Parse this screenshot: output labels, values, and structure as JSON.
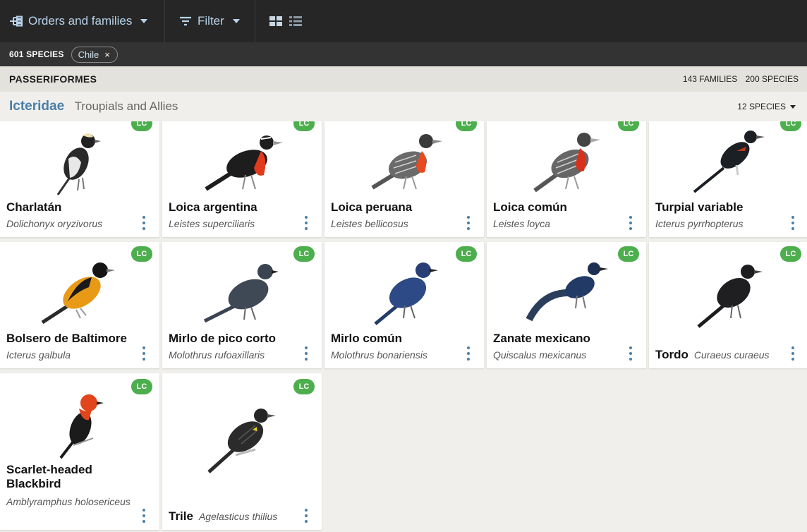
{
  "topbar": {
    "orders_label": "Orders and families",
    "filter_label": "Filter"
  },
  "filterbar": {
    "count": "601 SPECIES",
    "chip": "Chile",
    "chip_remove": "×"
  },
  "order": {
    "name": "PASSERIFORMES",
    "families": "143 FAMILIES",
    "species": "200 SPECIES"
  },
  "family": {
    "name": "Icteridae",
    "common": "Troupials and Allies",
    "count": "12 SPECIES"
  },
  "colors": {
    "topbar": "#262626",
    "link": "#4a7fa8",
    "lc_badge": "#4cae4c"
  },
  "cards": [
    {
      "common": "Charlatán",
      "scientific": "Dolichonyx oryzivorus",
      "status": "LC"
    },
    {
      "common": "Loica argentina",
      "scientific": "Leistes superciliaris",
      "status": "LC"
    },
    {
      "common": "Loica peruana",
      "scientific": "Leistes bellicosus",
      "status": "LC"
    },
    {
      "common": "Loica común",
      "scientific": "Leistes loyca",
      "status": "LC"
    },
    {
      "common": "Turpial variable",
      "scientific": "Icterus pyrrhopterus",
      "status": "LC"
    },
    {
      "common": "Bolsero de Baltimore",
      "scientific": "Icterus galbula",
      "status": "LC"
    },
    {
      "common": "Mirlo de pico corto",
      "scientific": "Molothrus rufoaxillaris",
      "status": "LC"
    },
    {
      "common": "Mirlo común",
      "scientific": "Molothrus bonariensis",
      "status": "LC"
    },
    {
      "common": "Zanate mexicano",
      "scientific": "Quiscalus mexicanus",
      "status": "LC"
    },
    {
      "common": "Tordo",
      "scientific": "Curaeus curaeus",
      "status": "LC"
    },
    {
      "common": "Scarlet-headed Blackbird",
      "scientific": "Amblyramphus holosericeus",
      "status": "LC"
    },
    {
      "common": "Trile",
      "scientific": "Agelasticus thilius",
      "status": "LC"
    }
  ]
}
